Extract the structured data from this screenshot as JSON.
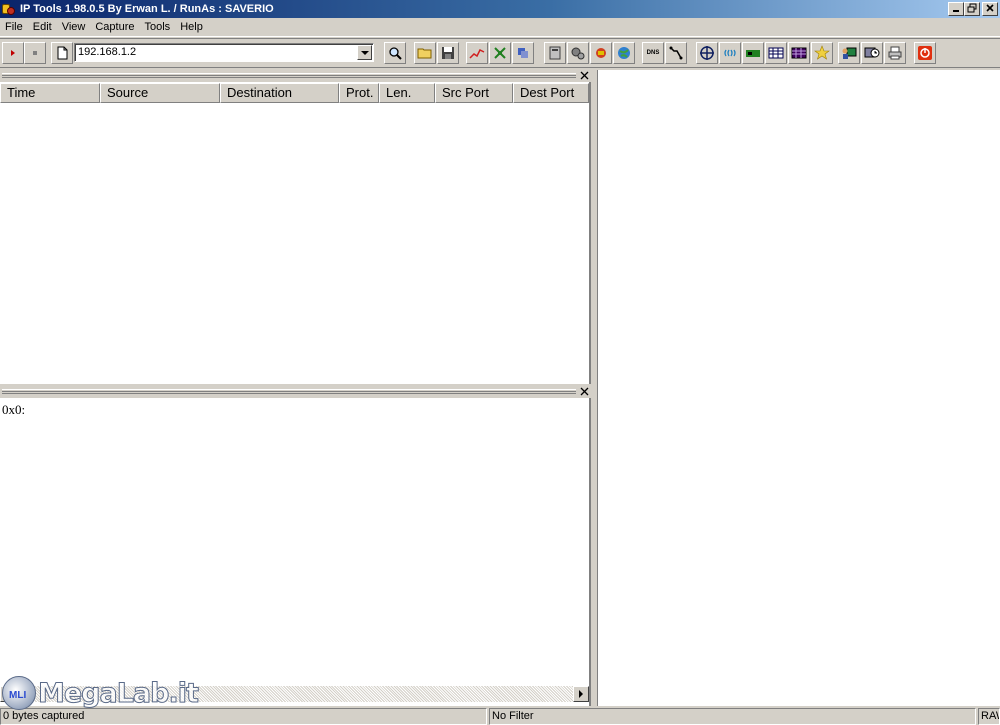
{
  "window": {
    "title": "IP Tools 1.98.0.5 By Erwan L. / RunAs : SAVERIO",
    "minimize_icon": "minimize-icon",
    "restore_icon": "restore-icon",
    "close_icon": "close-icon"
  },
  "menu": [
    "File",
    "Edit",
    "View",
    "Capture",
    "Tools",
    "Help"
  ],
  "toolbar": {
    "address_value": "192.168.1.2",
    "buttons": [
      "start-capture-icon",
      "stop-capture-icon",
      "new-document-icon",
      "search-icon",
      "open-folder-icon",
      "save-icon",
      "graph-icon",
      "network-map-icon",
      "connections-icon",
      "server-icon",
      "settings-gears-icon",
      "packet-tools-icon",
      "globe-icon",
      "dns-icon",
      "traceroute-icon",
      "target-icon",
      "wireless-icon",
      "network-card-icon",
      "table-icon",
      "table-dark-icon",
      "star-icon",
      "user-monitor-icon",
      "clock-monitor-icon",
      "printer-icon",
      "power-icon"
    ],
    "dns_label": "DNS"
  },
  "packet_list": {
    "columns": [
      "Time",
      "Source",
      "Destination",
      "Prot.",
      "Len.",
      "Src Port",
      "Dest Port"
    ]
  },
  "hex_view": {
    "text": "0x0:"
  },
  "status": {
    "captured": "0 bytes captured",
    "filter": "No Filter",
    "mode": "RAW"
  },
  "watermark": {
    "badge": "MLI",
    "text": "MegaLab.it"
  }
}
